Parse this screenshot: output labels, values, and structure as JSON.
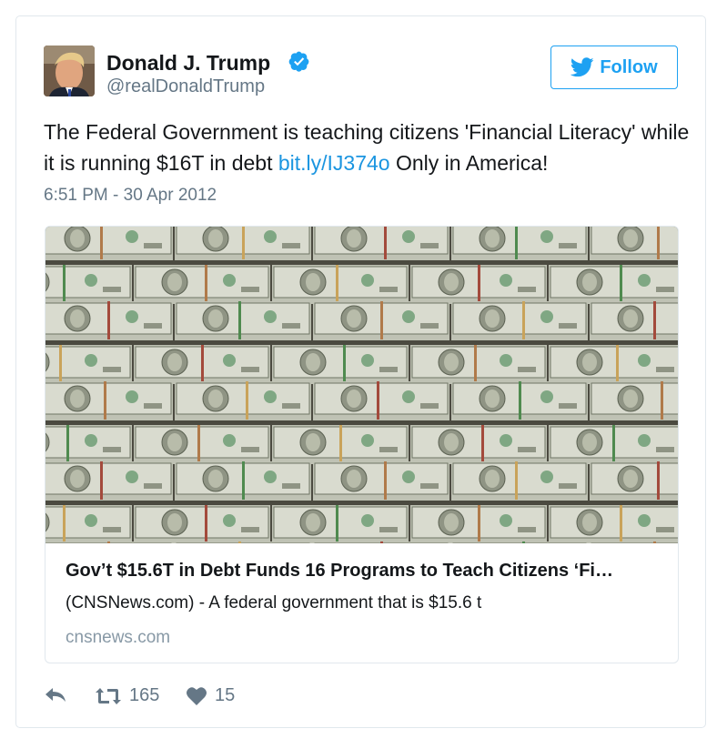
{
  "author": {
    "name": "Donald J. Trump",
    "handle": "@realDonaldTrump",
    "verified_icon": "verified-badge-icon"
  },
  "follow_button": {
    "label": "Follow",
    "icon": "twitter-bird-icon"
  },
  "tweet": {
    "text_before_link": "The Federal Government is teaching citizens 'Financial Literacy' while it is running $16T in debt ",
    "link_text": "bit.ly/IJ374o",
    "text_after_link": " Only in America!",
    "timestamp": "6:51 PM - 30 Apr 2012"
  },
  "card": {
    "image_subject": "stacks of banded $100 bills",
    "title": "Gov’t $15.6T in Debt Funds 16 Programs to Teach Citizens ‘Fi…",
    "description": "(CNSNews.com) - A federal government that is $15.6 t",
    "domain": "cnsnews.com"
  },
  "actions": {
    "reply_icon": "reply-icon",
    "retweet_icon": "retweet-icon",
    "retweet_count": "165",
    "like_icon": "heart-icon",
    "like_count": "15"
  },
  "colors": {
    "accent": "#1da1f2",
    "link": "#1b95e0",
    "secondary_text": "#657786",
    "border": "#e1e8ed"
  }
}
